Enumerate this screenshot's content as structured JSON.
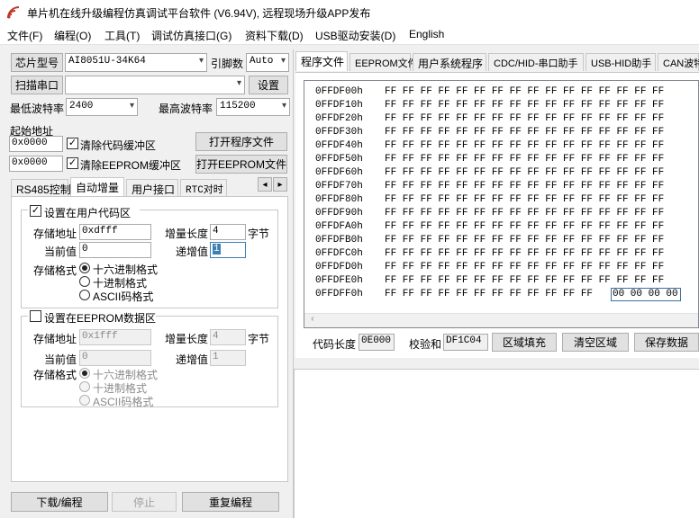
{
  "window": {
    "title": "单片机在线升级编程仿真调试平台软件 (V6.94V), 远程现场升级APP发布"
  },
  "menu": [
    "文件(F)",
    "编程(O)",
    "工具(T)",
    "调试仿真接口(G)",
    "资料下载(D)",
    "USB驱动安装(D)",
    "English"
  ],
  "left": {
    "chip_label": "芯片型号",
    "chip_value": "AI8051U-34K64",
    "pins_label": "引脚数",
    "pins_value": "Auto",
    "scan_button": "扫描串口",
    "port_value": "",
    "settings_button": "设置",
    "min_baud_label": "最低波特率",
    "min_baud_value": "2400",
    "max_baud_label": "最高波特率",
    "max_baud_value": "115200",
    "start_addr_label": "起始地址",
    "code_addr": "0x0000",
    "clear_code_label": "清除代码缓冲区",
    "open_prog_button": "打开程序文件",
    "eeprom_addr": "0x0000",
    "clear_eeprom_label": "清除EEPROM缓冲区",
    "open_eeprom_button": "打开EEPROM文件",
    "tabs": [
      "RS485控制",
      "自动增量",
      "用户接口",
      "RTC对时"
    ],
    "scroll_left": "◂",
    "scroll_right": "▸",
    "user_code": {
      "title": "设置在用户代码区",
      "store_addr_label": "存储地址",
      "store_addr_value": "0xdfff",
      "inc_len_label": "增量长度",
      "inc_len_value": "4",
      "inc_len_unit": "字节",
      "cur_label": "当前值",
      "cur_value": "0",
      "step_label": "递增值",
      "step_value": "1",
      "format_label": "存储格式",
      "formats": [
        "十六进制格式",
        "十进制格式",
        "ASCII码格式"
      ]
    },
    "eeprom": {
      "title": "设置在EEPROM数据区",
      "store_addr_label": "存储地址",
      "store_addr_value": "0x1fff",
      "inc_len_label": "增量长度",
      "inc_len_value": "4",
      "inc_len_unit": "字节",
      "cur_label": "当前值",
      "cur_value": "0",
      "step_label": "递增值",
      "step_value": "1",
      "format_label": "存储格式",
      "formats": [
        "十六进制格式",
        "十进制格式",
        "ASCII码格式"
      ]
    },
    "download_button": "下载/编程",
    "stop_button": "停止",
    "reprogram_button": "重复编程"
  },
  "right": {
    "tabs": [
      "程序文件",
      "EEPROM文件",
      "用户系统程序",
      "CDC/HID-串口助手",
      "USB-HID助手",
      "CAN波特"
    ],
    "hex_rows": [
      {
        "addr": "0FFDF00h",
        "bytes": "FF FF FF FF FF FF FF FF FF FF FF FF FF FF FF FF"
      },
      {
        "addr": "0FFDF10h",
        "bytes": "FF FF FF FF FF FF FF FF FF FF FF FF FF FF FF FF"
      },
      {
        "addr": "0FFDF20h",
        "bytes": "FF FF FF FF FF FF FF FF FF FF FF FF FF FF FF FF"
      },
      {
        "addr": "0FFDF30h",
        "bytes": "FF FF FF FF FF FF FF FF FF FF FF FF FF FF FF FF"
      },
      {
        "addr": "0FFDF40h",
        "bytes": "FF FF FF FF FF FF FF FF FF FF FF FF FF FF FF FF"
      },
      {
        "addr": "0FFDF50h",
        "bytes": "FF FF FF FF FF FF FF FF FF FF FF FF FF FF FF FF"
      },
      {
        "addr": "0FFDF60h",
        "bytes": "FF FF FF FF FF FF FF FF FF FF FF FF FF FF FF FF"
      },
      {
        "addr": "0FFDF70h",
        "bytes": "FF FF FF FF FF FF FF FF FF FF FF FF FF FF FF FF"
      },
      {
        "addr": "0FFDF80h",
        "bytes": "FF FF FF FF FF FF FF FF FF FF FF FF FF FF FF FF"
      },
      {
        "addr": "0FFDF90h",
        "bytes": "FF FF FF FF FF FF FF FF FF FF FF FF FF FF FF FF"
      },
      {
        "addr": "0FFDFA0h",
        "bytes": "FF FF FF FF FF FF FF FF FF FF FF FF FF FF FF FF"
      },
      {
        "addr": "0FFDFB0h",
        "bytes": "FF FF FF FF FF FF FF FF FF FF FF FF FF FF FF FF"
      },
      {
        "addr": "0FFDFC0h",
        "bytes": "FF FF FF FF FF FF FF FF FF FF FF FF FF FF FF FF"
      },
      {
        "addr": "0FFDFD0h",
        "bytes": "FF FF FF FF FF FF FF FF FF FF FF FF FF FF FF FF"
      },
      {
        "addr": "0FFDFE0h",
        "bytes": "FF FF FF FF FF FF FF FF FF FF FF FF FF FF FF FF"
      },
      {
        "addr": "0FFDFF0h",
        "bytes": "FF FF FF FF FF FF FF FF FF FF FF FF"
      }
    ],
    "hex_highlight": "00 00 00 00",
    "code_len_label": "代码长度",
    "code_len_value": "0E000",
    "checksum_label": "校验和",
    "checksum_value": "DF1C04",
    "fill_button": "区域填充",
    "clear_button": "清空区域",
    "save_button": "保存数据"
  },
  "colors": {
    "accent": "#3c7fb1",
    "highlight_border": "#3b6fa8"
  }
}
